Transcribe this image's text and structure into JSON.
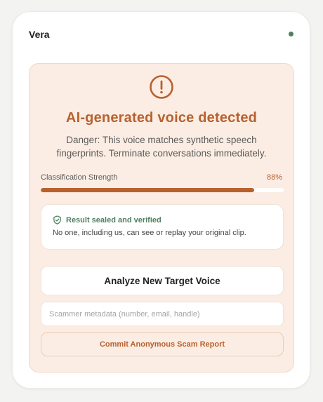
{
  "header": {
    "title": "Vera",
    "status_color": "#4f7f5f"
  },
  "result": {
    "icon": "exclamation-circle-icon",
    "heading": "AI-generated voice detected",
    "message": "Danger: This voice matches synthetic speech fingerprints. Terminate conversations immediately.",
    "accent_color": "#b8612f"
  },
  "strength": {
    "label": "Classification Strength",
    "value_text": "88%",
    "value": 0.88
  },
  "verification": {
    "icon": "shield-check-icon",
    "title": "Result sealed and verified",
    "text": "No one, including us, can see or replay your original clip.",
    "color": "#4f7f5f"
  },
  "actions": {
    "analyze_label": "Analyze New Target Voice",
    "metadata_placeholder": "Scammer metadata (number, email, handle)",
    "report_label": "Commit Anonymous Scam Report"
  }
}
